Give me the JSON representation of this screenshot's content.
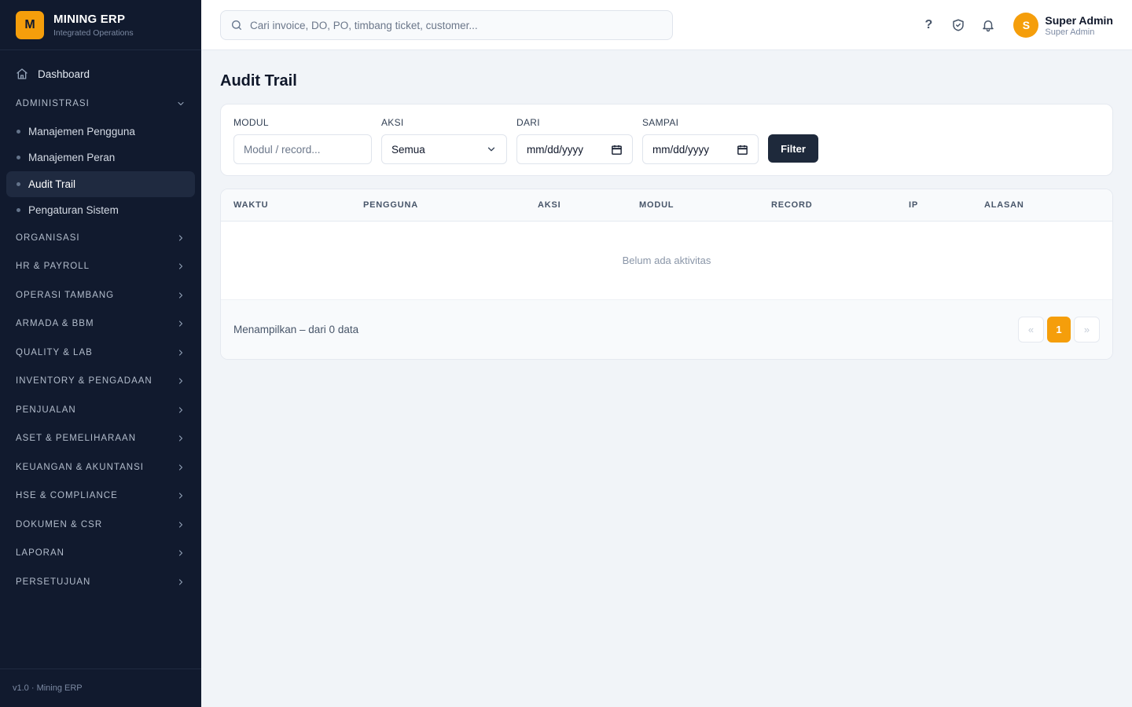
{
  "brand": {
    "logo_letter": "M",
    "title": "MINING ERP",
    "subtitle": "Integrated Operations"
  },
  "sidebar": {
    "dashboard_label": "Dashboard",
    "admin_section": "ADMINISTRASI",
    "admin_items": [
      "Manajemen Pengguna",
      "Manajemen Peran",
      "Audit Trail",
      "Pengaturan Sistem"
    ],
    "active_item": "Audit Trail",
    "sections": [
      "ORGANISASI",
      "HR & PAYROLL",
      "OPERASI TAMBANG",
      "ARMADA & BBM",
      "QUALITY & LAB",
      "INVENTORY & PENGADAAN",
      "PENJUALAN",
      "ASET & PEMELIHARAAN",
      "KEUANGAN & AKUNTANSI",
      "HSE & COMPLIANCE",
      "DOKUMEN & CSR",
      "LAPORAN",
      "PERSETUJUAN"
    ],
    "footer": "v1.0 · Mining ERP"
  },
  "topbar": {
    "search_placeholder": "Cari invoice, DO, PO, timbang ticket, customer...",
    "help_glyph": "?",
    "avatar_letter": "S",
    "user_name": "Super Admin",
    "user_role": "Super Admin"
  },
  "page": {
    "title": "Audit Trail"
  },
  "filters": {
    "modul_label": "MODUL",
    "modul_placeholder": "Modul / record...",
    "aksi_label": "AKSI",
    "aksi_value": "Semua",
    "dari_label": "DARI",
    "dari_value": "mm/dd/yyyy",
    "sampai_label": "SAMPAI",
    "sampai_value": "mm/dd/yyyy",
    "filter_button": "Filter"
  },
  "table": {
    "columns": [
      "WAKTU",
      "PENGGUNA",
      "AKSI",
      "MODUL",
      "RECORD",
      "IP",
      "ALASAN"
    ],
    "empty_text": "Belum ada aktivitas",
    "footer_text": "Menampilkan – dari 0 data",
    "pager": {
      "prev": "«",
      "current": "1",
      "next": "»"
    }
  },
  "colors": {
    "accent": "#f59e0b",
    "sidebar_bg": "#111a2e",
    "button_dark": "#1e293b"
  }
}
